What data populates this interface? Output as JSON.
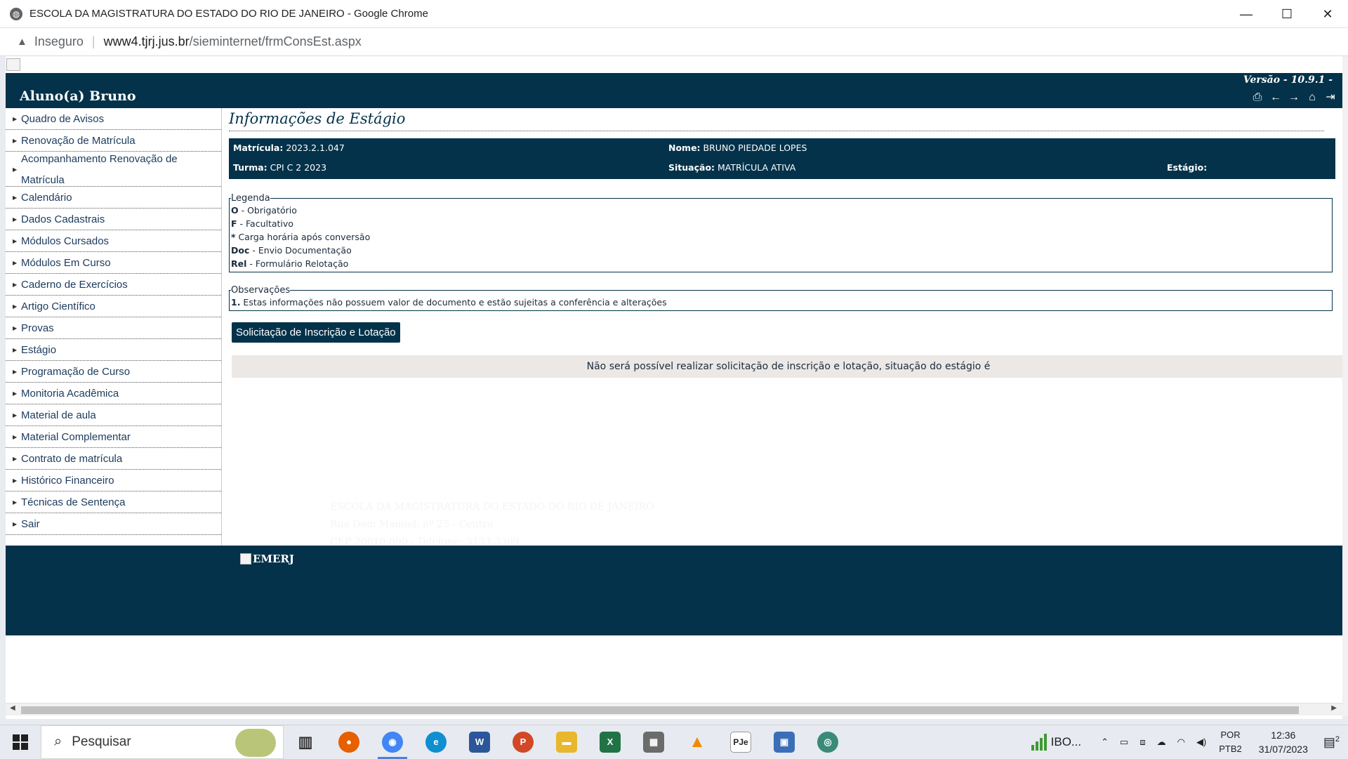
{
  "window": {
    "title": "ESCOLA DA MAGISTRATURA DO ESTADO DO RIO DE JANEIRO - Google Chrome",
    "controls": {
      "minimize": "—",
      "maximize": "☐",
      "close": "✕"
    }
  },
  "address_bar": {
    "security_label": "Inseguro",
    "url_host": "www4.tjrj.jus.br",
    "url_path": "/sieminternet/frmConsEst.aspx"
  },
  "header": {
    "student": "Aluno(a) Bruno",
    "version": "Versão - 10.9.1 -",
    "tool_icons": [
      "print-icon",
      "back-arrow-icon",
      "forward-arrow-icon",
      "home-icon",
      "logout-icon"
    ]
  },
  "sidebar": {
    "items": [
      {
        "label": "Quadro de Avisos"
      },
      {
        "label": "Renovação de Matrícula"
      },
      {
        "label": "Acompanhamento Renovação de Matrícula"
      },
      {
        "label": "Calendário"
      },
      {
        "label": "Dados Cadastrais"
      },
      {
        "label": "Módulos Cursados"
      },
      {
        "label": "Módulos Em Curso"
      },
      {
        "label": "Caderno de Exercícios"
      },
      {
        "label": "Artigo Científico"
      },
      {
        "label": "Provas"
      },
      {
        "label": "Estágio"
      },
      {
        "label": "Programação de Curso"
      },
      {
        "label": "Monitoria Acadêmica"
      },
      {
        "label": "Material de aula"
      },
      {
        "label": "Material Complementar"
      },
      {
        "label": "Contrato de matrícula"
      },
      {
        "label": "Histórico Financeiro"
      },
      {
        "label": "Técnicas de Sentença"
      },
      {
        "label": "Sair"
      }
    ]
  },
  "main": {
    "title": "Informações de Estágio",
    "info": {
      "matricula_label": "Matrícula:",
      "matricula_value": "2023.2.1.047",
      "nome_label": "Nome:",
      "nome_value": "BRUNO PIEDADE LOPES",
      "turma_label": "Turma:",
      "turma_value": "CPI C 2 2023",
      "situacao_label": "Situação:",
      "situacao_value": "MATRÍCULA ATIVA",
      "estagio_label": "Estágio:"
    },
    "legenda": {
      "title": "Legenda",
      "rows": [
        {
          "key": "O",
          "text": " - Obrigatório"
        },
        {
          "key": "F",
          "text": " - Facultativo"
        },
        {
          "key": "*",
          "text": " Carga horária após conversão"
        },
        {
          "key": "Doc",
          "text": " - Envio Documentação"
        },
        {
          "key": "Rel",
          "text": " - Formulário Relotação"
        }
      ]
    },
    "observacoes": {
      "title": "Observações",
      "rows": [
        {
          "key": "1.",
          "text": " Estas informações não possuem valor de documento e estão sujeitas a conferência e alterações"
        }
      ]
    },
    "button_label": "Solicitação de Inscrição e Lotação",
    "notice": "Não será possível realizar solicitação de inscrição e lotação, situação do estágio é"
  },
  "faint_footer": {
    "line1": "ESCOLA DA MAGISTRATURA DO ESTADO DO RIO DE JANEIRO",
    "line2": "Rua Dom Manuel, nº 25 - Centro",
    "line3": "CEP 20010-090 - Telefone: 3133-3369"
  },
  "footer": {
    "logo_alt": "EMERJ"
  },
  "taskbar": {
    "search_placeholder": "Pesquisar",
    "ibo_label": "IBO...",
    "lang_line1": "POR",
    "lang_line2": "PTB2",
    "time": "12:36",
    "date": "31/07/2023",
    "notification_count": "2",
    "apps": [
      {
        "name": "task-view",
        "color": "#3b3b3b",
        "glyph": "▥"
      },
      {
        "name": "firefox",
        "color": "#e66000",
        "glyph": "●"
      },
      {
        "name": "chrome",
        "color": "#4285f4",
        "glyph": "◉"
      },
      {
        "name": "edge",
        "color": "#0f8fd1",
        "glyph": "e"
      },
      {
        "name": "word",
        "color": "#2b579a",
        "glyph": "W"
      },
      {
        "name": "powerpoint",
        "color": "#d24726",
        "glyph": "P"
      },
      {
        "name": "file-explorer",
        "color": "#e8b72c",
        "glyph": "▬"
      },
      {
        "name": "excel",
        "color": "#217346",
        "glyph": "X"
      },
      {
        "name": "calculator",
        "color": "#6b6b6b",
        "glyph": "▦"
      },
      {
        "name": "vlc",
        "color": "#f08a00",
        "glyph": "▲"
      },
      {
        "name": "pje",
        "color": "#ffffff",
        "glyph": "PJe"
      },
      {
        "name": "remote-desktop",
        "color": "#3a6fb8",
        "glyph": "▣"
      },
      {
        "name": "network-app",
        "color": "#3a8a7a",
        "glyph": "◎"
      }
    ]
  }
}
